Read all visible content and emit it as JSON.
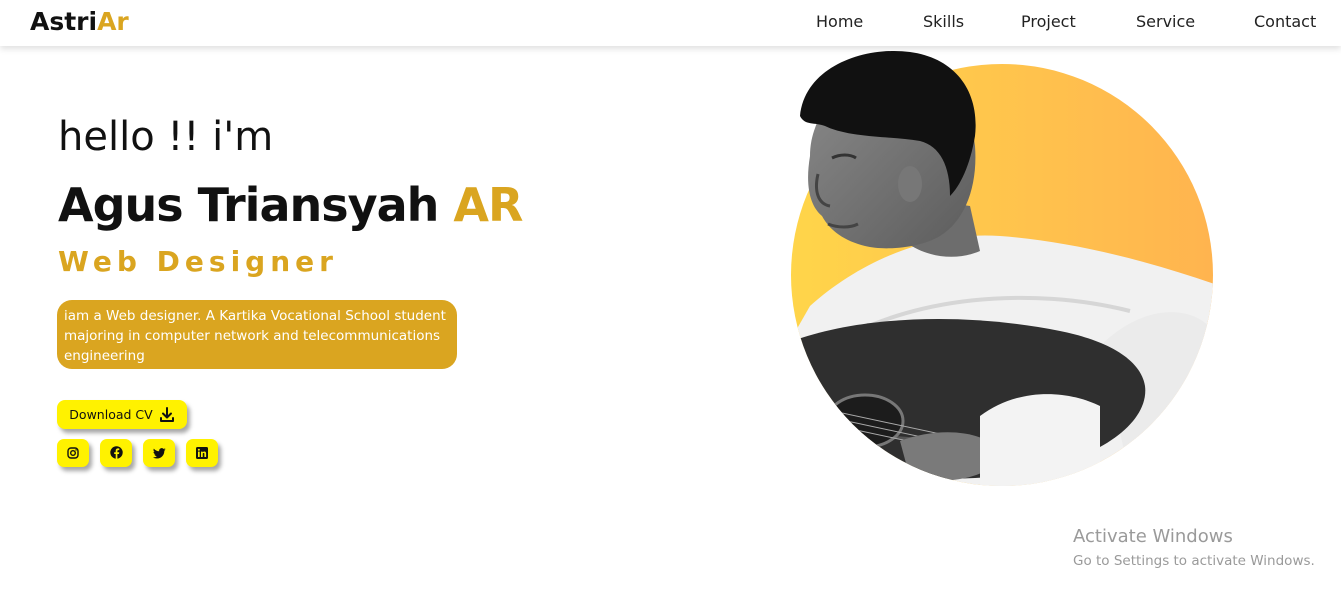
{
  "brand": {
    "logo_main": "Astri",
    "logo_accent": "Ar"
  },
  "nav": {
    "items": [
      {
        "label": "Home"
      },
      {
        "label": "Skills"
      },
      {
        "label": "Project"
      },
      {
        "label": "Service"
      },
      {
        "label": "Contact"
      }
    ]
  },
  "hero": {
    "greeting": "hello !! i'm",
    "name_main": "Agus Triansyah",
    "name_accent": "AR",
    "role": "Web Designer",
    "description": "iam a Web designer. A Kartika Vocational School student majoring in computer network and telecommunications engineering",
    "cv_button_label": "Download CV",
    "social_icons": [
      "instagram-icon",
      "facebook-icon",
      "twitter-icon",
      "linkedin-icon"
    ]
  },
  "watermark": {
    "title": "Activate Windows",
    "subtitle": "Go to Settings to activate Windows."
  },
  "colors": {
    "accent": "#DAA520",
    "button": "#FFF200",
    "circle_start": "#FFD54A",
    "circle_end": "#FFB44F"
  }
}
